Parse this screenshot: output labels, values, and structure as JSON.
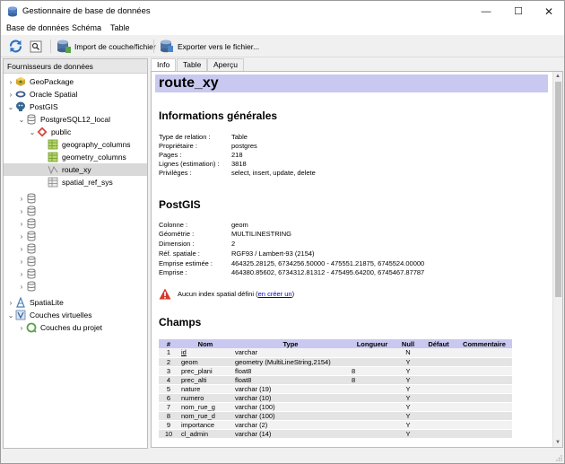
{
  "window": {
    "title": "Gestionnaire de base de données",
    "min_symbol": "—",
    "max_symbol": "☐",
    "close_symbol": "✕"
  },
  "menu": [
    "Base de données",
    "Schéma",
    "Table"
  ],
  "toolbar": {
    "refresh_icon": "refresh-icon",
    "info_icon": "info-icon",
    "import_label": "Import de couche/fichier",
    "export_label": "Exporter vers le fichier..."
  },
  "left_panel": {
    "header": "Fournisseurs de données",
    "tree": [
      {
        "label": "GeoPackage",
        "icon": "geopackage-icon",
        "twisty": "›"
      },
      {
        "label": "Oracle Spatial",
        "icon": "oracle-icon",
        "twisty": "›"
      },
      {
        "label": "PostGIS",
        "icon": "postgis-icon",
        "twisty": "⌄"
      },
      {
        "label": "PostgreSQL12_local",
        "icon": "database-icon",
        "twisty": "⌄"
      },
      {
        "label": "public",
        "icon": "schema-icon",
        "twisty": "⌄"
      },
      {
        "label": "geography_columns",
        "icon": "table-icon",
        "twisty": ""
      },
      {
        "label": "geometry_columns",
        "icon": "table-icon",
        "twisty": ""
      },
      {
        "label": "route_xy",
        "icon": "line-layer-icon",
        "twisty": ""
      },
      {
        "label": "spatial_ref_sys",
        "icon": "table-plain-icon",
        "twisty": ""
      },
      {
        "label": "",
        "icon": "database-icon",
        "twisty": "›"
      },
      {
        "label": "",
        "icon": "database-icon",
        "twisty": "›"
      },
      {
        "label": "",
        "icon": "database-icon",
        "twisty": "›"
      },
      {
        "label": "",
        "icon": "database-icon",
        "twisty": "›"
      },
      {
        "label": "",
        "icon": "database-icon",
        "twisty": "›"
      },
      {
        "label": "",
        "icon": "database-icon",
        "twisty": "›"
      },
      {
        "label": "",
        "icon": "database-icon",
        "twisty": "›"
      },
      {
        "label": "",
        "icon": "database-icon",
        "twisty": "›"
      },
      {
        "label": "SpatiaLite",
        "icon": "spatialite-icon",
        "twisty": "›"
      },
      {
        "label": "Couches virtuelles",
        "icon": "virtual-layer-icon",
        "twisty": "⌄"
      },
      {
        "label": "Couches du projet",
        "icon": "project-layers-icon",
        "twisty": "›"
      }
    ]
  },
  "tabs": [
    "Info",
    "Table",
    "Aperçu"
  ],
  "info": {
    "relation_name": "route_xy",
    "general_heading": "Informations générales",
    "general": [
      {
        "label": "Type de relation :",
        "value": "Table"
      },
      {
        "label": "Propriétaire :",
        "value": "postgres"
      },
      {
        "label": "Pages :",
        "value": "218"
      },
      {
        "label": "Lignes (estimation) :",
        "value": "3818"
      },
      {
        "label": "Privilèges :",
        "value": "select, insert, update, delete"
      }
    ],
    "postgis_heading": "PostGIS",
    "postgis": [
      {
        "label": "Colonne :",
        "value": "geom"
      },
      {
        "label": "Géométrie :",
        "value": "MULTILINESTRING"
      },
      {
        "label": "Dimension :",
        "value": "2"
      },
      {
        "label": "Réf. spatiale :",
        "value": "RGF93 / Lambert-93 (2154)"
      },
      {
        "label": "Emprise estimée :",
        "value": "464325.28125, 6734256.50000 - 475551.21875, 6745524.00000"
      },
      {
        "label": "Emprise :",
        "value": "464380.85602, 6734312.81312 - 475495.64200, 6745467.87787"
      }
    ],
    "warning_text": "Aucun index spatial défini (",
    "warning_link": "en créer un",
    "warning_close": ")",
    "fields_heading": "Champs",
    "fields_columns": [
      "#",
      "Nom",
      "Type",
      "Longueur",
      "Null",
      "Défaut",
      "Commentaire"
    ],
    "fields": [
      {
        "n": "1",
        "name": "id",
        "type": "varchar",
        "len": "",
        "null": "N",
        "def": "",
        "comment": ""
      },
      {
        "n": "2",
        "name": "geom",
        "type": "geometry (MultiLineString,2154)",
        "len": "",
        "null": "Y",
        "def": "",
        "comment": ""
      },
      {
        "n": "3",
        "name": "prec_plani",
        "type": "float8",
        "len": "8",
        "null": "Y",
        "def": "",
        "comment": ""
      },
      {
        "n": "4",
        "name": "prec_alti",
        "type": "float8",
        "len": "8",
        "null": "Y",
        "def": "",
        "comment": ""
      },
      {
        "n": "5",
        "name": "nature",
        "type": "varchar (19)",
        "len": "",
        "null": "Y",
        "def": "",
        "comment": ""
      },
      {
        "n": "6",
        "name": "numero",
        "type": "varchar (10)",
        "len": "",
        "null": "Y",
        "def": "",
        "comment": ""
      },
      {
        "n": "7",
        "name": "nom_rue_g",
        "type": "varchar (100)",
        "len": "",
        "null": "Y",
        "def": "",
        "comment": ""
      },
      {
        "n": "8",
        "name": "nom_rue_d",
        "type": "varchar (100)",
        "len": "",
        "null": "Y",
        "def": "",
        "comment": ""
      },
      {
        "n": "9",
        "name": "importance",
        "type": "varchar (2)",
        "len": "",
        "null": "Y",
        "def": "",
        "comment": ""
      },
      {
        "n": "10",
        "name": "cl_admin",
        "type": "varchar (14)",
        "len": "",
        "null": "Y",
        "def": "",
        "comment": ""
      }
    ]
  }
}
